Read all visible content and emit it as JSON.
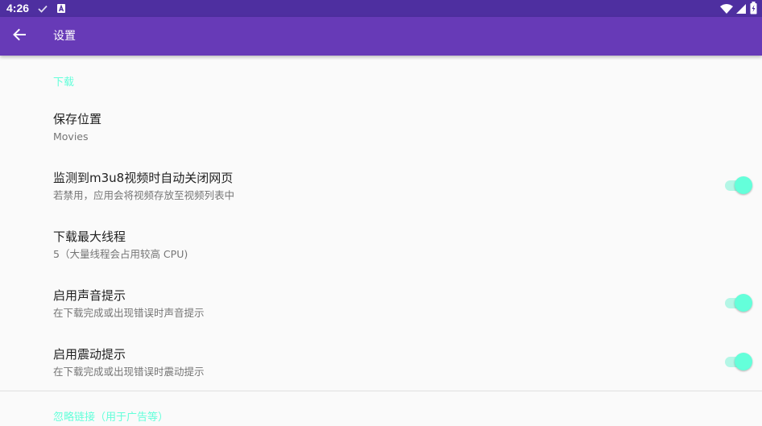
{
  "status_bar": {
    "time": "4:26"
  },
  "toolbar": {
    "title": "设置"
  },
  "categories": {
    "download": "下载",
    "ignore_links": "忽略链接（用于广告等）"
  },
  "preferences": [
    {
      "title": "保存位置",
      "summary": "Movies",
      "has_switch": false
    },
    {
      "title": "监测到m3u8视频时自动关闭网页",
      "summary": "若禁用，应用会将视频存放至视频列表中",
      "has_switch": true,
      "checked": true
    },
    {
      "title": "下载最大线程",
      "summary": "5（大量线程会占用较高 CPU)",
      "has_switch": false
    },
    {
      "title": "启用声音提示",
      "summary": "在下载完成或出现错误时声音提示",
      "has_switch": true,
      "checked": true
    },
    {
      "title": "启用震动提示",
      "summary": "在下载完成或出现错误时震动提示",
      "has_switch": true,
      "checked": true
    }
  ],
  "colors": {
    "status_bar": "#4e2fa0",
    "toolbar": "#673ab7",
    "accent": "#64ffda"
  },
  "icons": {
    "back": "arrow-back-icon",
    "status": [
      "check-icon",
      "a-notification-icon",
      "wifi-icon",
      "cellular-signal-icon",
      "battery-charging-icon"
    ]
  }
}
